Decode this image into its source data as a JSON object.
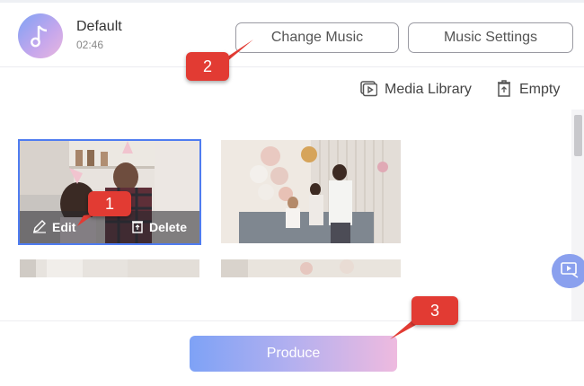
{
  "music": {
    "name": "Default",
    "duration": "02:46",
    "change_label": "Change Music",
    "settings_label": "Music Settings"
  },
  "toolbar": {
    "media_library_label": "Media Library",
    "empty_label": "Empty"
  },
  "thumbnails": {
    "edit_label": "Edit",
    "delete_label": "Delete"
  },
  "footer": {
    "produce_label": "Produce"
  },
  "callouts": [
    "1",
    "2",
    "3"
  ],
  "colors": {
    "accent": "#4f7cf0",
    "callout": "#e23b33",
    "gradient_start": "#7ea2f6",
    "gradient_end": "#eebadf"
  }
}
